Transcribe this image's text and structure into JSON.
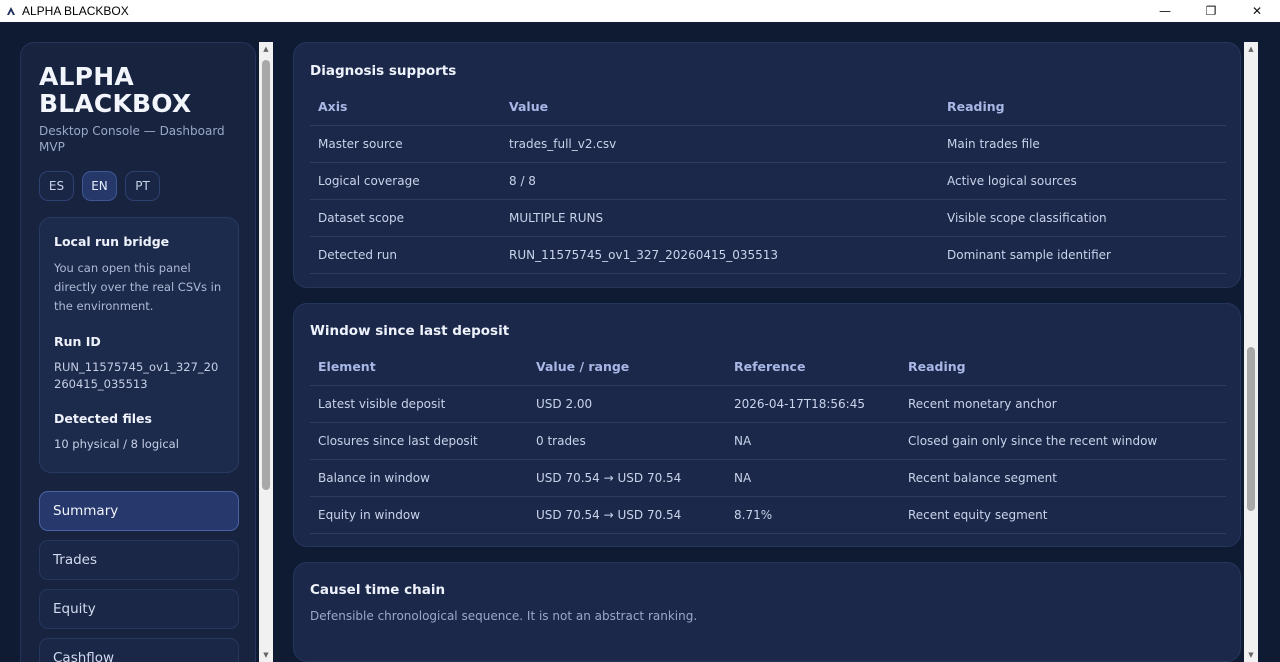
{
  "window": {
    "title": "ALPHA BLACKBOX",
    "minimize_glyph": "—",
    "maximize_glyph": "❐",
    "close_glyph": "✕"
  },
  "sidebar": {
    "brand": "ALPHA BLACKBOX",
    "subtitle": "Desktop Console — Dashboard MVP",
    "languages": [
      "ES",
      "EN",
      "PT"
    ],
    "active_language": "EN",
    "bridge": {
      "title": "Local run bridge",
      "description": "You can open this panel directly over the real CSVs in the environment.",
      "run_id_label": "Run ID",
      "run_id_value": "RUN_11575745_ov1_327_20260415_035513",
      "files_label": "Detected files",
      "files_value": "10 physical / 8 logical"
    },
    "nav": [
      {
        "label": "Summary",
        "active": true
      },
      {
        "label": "Trades",
        "active": false
      },
      {
        "label": "Equity",
        "active": false
      },
      {
        "label": "Cashflow",
        "active": false
      }
    ]
  },
  "diagnosis": {
    "title": "Diagnosis supports",
    "headers": [
      "Axis",
      "Value",
      "Reading"
    ],
    "rows": [
      [
        "Master source",
        "trades_full_v2.csv",
        "Main trades file"
      ],
      [
        "Logical coverage",
        "8 / 8",
        "Active logical sources"
      ],
      [
        "Dataset scope",
        "MULTIPLE RUNS",
        "Visible scope classification"
      ],
      [
        "Detected run",
        "RUN_11575745_ov1_327_20260415_035513",
        "Dominant sample identifier"
      ]
    ]
  },
  "window_since_deposit": {
    "title": "Window since last deposit",
    "headers": [
      "Element",
      "Value / range",
      "Reference",
      "Reading"
    ],
    "rows": [
      [
        "Latest visible deposit",
        "USD 2.00",
        "2026-04-17T18:56:45",
        "Recent monetary anchor"
      ],
      [
        "Closures since last deposit",
        "0 trades",
        "NA",
        "Closed gain only since the recent window"
      ],
      [
        "Balance in window",
        "USD 70.54 → USD 70.54",
        "NA",
        "Recent balance segment"
      ],
      [
        "Equity in window",
        "USD 70.54 → USD 70.54",
        "8.71%",
        "Recent equity segment"
      ]
    ]
  },
  "causal_chain": {
    "title": "Causel time chain",
    "description": "Defensible chronological sequence. It is not an abstract ranking."
  }
}
